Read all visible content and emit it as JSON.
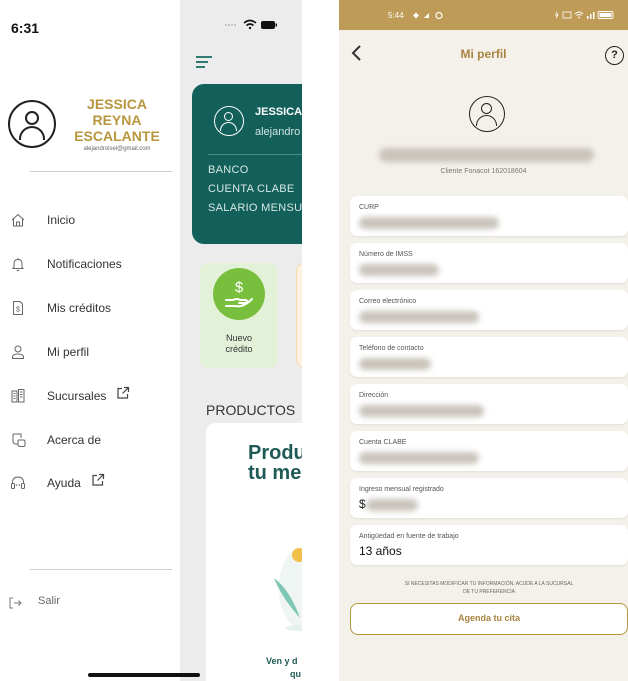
{
  "left_screen": {
    "status_time": "6:31",
    "user": {
      "name_lines": [
        "JESSICA",
        "REYNA",
        "ESCALANTE"
      ],
      "email": "alejandroisel@gmail.com"
    },
    "menu": [
      {
        "label": "Inicio",
        "icon": "home-icon"
      },
      {
        "label": "Notificaciones",
        "icon": "bell-icon"
      },
      {
        "label": "Mis créditos",
        "icon": "credit-document-icon"
      },
      {
        "label": "Mi perfil",
        "icon": "user-icon"
      },
      {
        "label": "Sucursales",
        "icon": "building-icon",
        "external": true
      },
      {
        "label": "Acerca de",
        "icon": "info-hand-icon"
      },
      {
        "label": "Ayuda",
        "icon": "support-icon",
        "external": true
      }
    ],
    "logout_label": "Salir",
    "behind": {
      "card_name": "JESSICA",
      "card_email": "alejandro",
      "card_lines": [
        "BANCO",
        "CUENTA CLABE",
        "SALARIO MENSUAL"
      ],
      "new_credit_lines": [
        "Nuevo",
        "crédito"
      ],
      "products_title": "PRODUCTOS",
      "product_heading_lines": [
        "Produ",
        "tu me"
      ],
      "product_footer_lines": [
        "Ven y d",
        "qu"
      ]
    }
  },
  "right_screen": {
    "status_time": "5:44",
    "title": "Mi perfil",
    "help_symbol": "?",
    "client_id": "Cliente Fonacot 162018604",
    "fields": [
      {
        "label": "CURP",
        "value": ""
      },
      {
        "label": "Número de IMSS",
        "value": ""
      },
      {
        "label": "Correo electrónico",
        "value": ""
      },
      {
        "label": "Teléfono de contacto",
        "value": ""
      },
      {
        "label": "Dirección",
        "value": ""
      },
      {
        "label": "Cuenta CLABE",
        "value": ""
      },
      {
        "label": "Ingreso mensual registrado",
        "value": "$"
      },
      {
        "label": "Antigüedad en fuente de trabajo",
        "value": "13 años"
      }
    ],
    "notice_lines": [
      "SI NECESITAS MODIFICAR TU INFORMACIÓN, ACUDE A LA SUCURSAL",
      "DE TU PREFERENCIA"
    ],
    "appointment_button": "Agenda tu cita"
  },
  "colors": {
    "accent_gold": "#b8963d",
    "teal": "#13605b",
    "green": "#79bf3e",
    "status_bar": "#bf9b58"
  }
}
